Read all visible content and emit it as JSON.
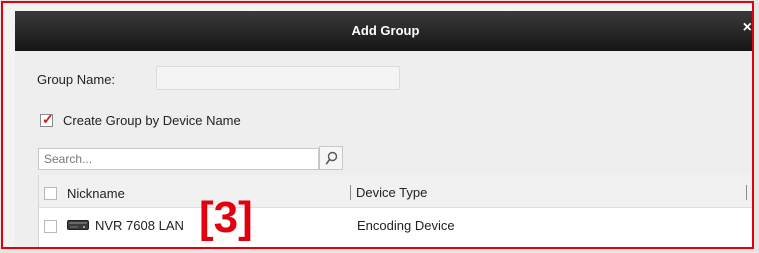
{
  "dialog": {
    "title": "Add Group",
    "close_glyph": "×",
    "group_name": {
      "label": "Group Name:",
      "value": ""
    },
    "create_by_device_name": {
      "label": "Create Group by Device Name",
      "checked": true
    },
    "search": {
      "placeholder": "Search...",
      "value": "",
      "icon": "search-icon"
    },
    "table": {
      "columns": [
        "Nickname",
        "Device Type"
      ],
      "rows": [
        {
          "nickname": "NVR 7608 LAN",
          "device_type": "Encoding Device",
          "icon": "nvr-device-icon",
          "checked": false
        }
      ]
    }
  },
  "annotation": {
    "step_label": "[3]",
    "color": "#e3000e"
  },
  "colors": {
    "titlebar": "#1e1e1e",
    "accent": "#e3000e",
    "check": "#d0191f"
  }
}
